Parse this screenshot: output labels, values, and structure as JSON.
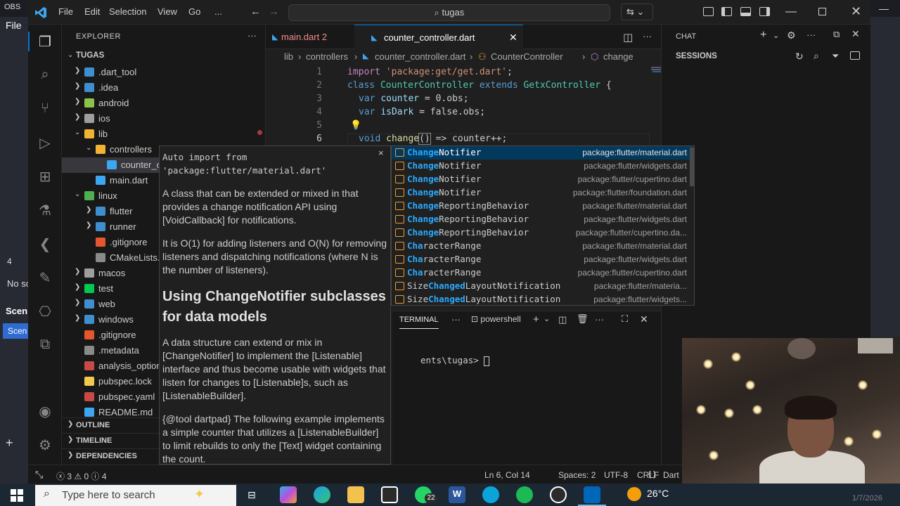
{
  "obs": {
    "title": "OBS",
    "menu_file": "File",
    "no_source": "No sc",
    "scenes_header": "Scen",
    "scene_item": "Scen",
    "left_value": "4"
  },
  "titlebar": {
    "menus": [
      "File",
      "Edit",
      "Selection",
      "View",
      "Go",
      "..."
    ],
    "search": "tugas"
  },
  "sidebar": {
    "title": "EXPLORER",
    "root": "TUGAS",
    "tree": [
      {
        "label": ".dart_tool",
        "depth": 1,
        "folder": true,
        "open": false
      },
      {
        "label": ".idea",
        "depth": 1,
        "folder": true,
        "open": false
      },
      {
        "label": "android",
        "depth": 1,
        "folder": true,
        "open": false
      },
      {
        "label": "ios",
        "depth": 1,
        "folder": true,
        "open": false
      },
      {
        "label": "lib",
        "depth": 1,
        "folder": true,
        "open": true
      },
      {
        "label": "controllers",
        "depth": 2,
        "folder": true,
        "open": true
      },
      {
        "label": "counter_con",
        "depth": 3,
        "folder": false,
        "selected": true
      },
      {
        "label": "main.dart",
        "depth": 2,
        "folder": false
      },
      {
        "label": "linux",
        "depth": 1,
        "folder": true,
        "open": true
      },
      {
        "label": "flutter",
        "depth": 2,
        "folder": true,
        "open": false
      },
      {
        "label": "runner",
        "depth": 2,
        "folder": true,
        "open": false
      },
      {
        "label": ".gitignore",
        "depth": 2,
        "folder": false
      },
      {
        "label": "CMakeLists.tx",
        "depth": 2,
        "folder": false
      },
      {
        "label": "macos",
        "depth": 1,
        "folder": true,
        "open": false
      },
      {
        "label": "test",
        "depth": 1,
        "folder": true,
        "open": false
      },
      {
        "label": "web",
        "depth": 1,
        "folder": true,
        "open": false
      },
      {
        "label": "windows",
        "depth": 1,
        "folder": true,
        "open": false
      },
      {
        "label": ".gitignore",
        "depth": 1,
        "folder": false
      },
      {
        "label": ".metadata",
        "depth": 1,
        "folder": false
      },
      {
        "label": "analysis_option",
        "depth": 1,
        "folder": false
      },
      {
        "label": "pubspec.lock",
        "depth": 1,
        "folder": false
      },
      {
        "label": "pubspec.yaml",
        "depth": 1,
        "folder": false
      },
      {
        "label": "README.md",
        "depth": 1,
        "folder": false
      }
    ],
    "sections": [
      "OUTLINE",
      "TIMELINE",
      "DEPENDENCIES"
    ]
  },
  "tabs": [
    {
      "label": "main.dart",
      "badge": "2",
      "active": false
    },
    {
      "label": "counter_controller.dart",
      "active": true
    }
  ],
  "breadcrumb": [
    "lib",
    "controllers",
    "counter_controller.dart",
    "CounterController",
    "change"
  ],
  "code": {
    "line_numbers": [
      "1",
      "2",
      "3",
      "4",
      "5",
      "6"
    ],
    "l1_kw": "import",
    "l1_str": "'package:get/get.dart'",
    "l1_end": ";",
    "l2_kw": "class",
    "l2_cls": "CounterController",
    "l2_kw2": "extends",
    "l2_cls2": "GetxController",
    "l2_end": " {",
    "l3_kw": "var",
    "l3_var": "counter",
    "l3_rest": " = 0.obs;",
    "l4_kw": "var",
    "l4_var": "isDark",
    "l4_rest": " = false.obs;",
    "l6_kw": "void",
    "l6_fn": "change",
    "l6_paren": "()",
    "l6_rest": " => counter++;"
  },
  "hover": {
    "header": "Auto import from 'package:flutter/material.dart'",
    "close": "×",
    "p1": "A class that can be extended or mixed in that provides a change notification API using [VoidCallback] for notifications.",
    "p2": "It is O(1) for adding listeners and O(N) for removing listeners and dispatching notifications (where N is the number of listeners).",
    "h2": "Using ChangeNotifier subclasses for data models",
    "p3": "A data structure can extend or mix in [ChangeNotifier] to implement the [Listenable] interface and thus become usable with widgets that listen for changes to [Listenable]s, such as [ListenableBuilder].",
    "p4": "{@tool dartpad} The following example implements a simple counter that utilizes a [ListenableBuilder] to limit rebuilds to only the [Text] widget containing the count."
  },
  "suggestions": [
    {
      "match": "Change",
      "rest": "Notifier",
      "pkg": "package:flutter/material.dart"
    },
    {
      "match": "Change",
      "rest": "Notifier",
      "pkg": "package:flutter/widgets.dart"
    },
    {
      "match": "Change",
      "rest": "Notifier",
      "pkg": "package:flutter/cupertino.dart"
    },
    {
      "match": "Change",
      "rest": "Notifier",
      "pkg": "package:flutter/foundation.dart"
    },
    {
      "match": "Change",
      "rest": "ReportingBehavior",
      "pkg": "package:flutter/material.dart"
    },
    {
      "match": "Change",
      "rest": "ReportingBehavior",
      "pkg": "package:flutter/widgets.dart"
    },
    {
      "match": "Change",
      "rest": "ReportingBehavior",
      "pkg": "package:flutter/cupertino.da..."
    },
    {
      "match": "Cha",
      "rest": "racterRange",
      "pkg": "package:flutter/material.dart"
    },
    {
      "match": "Cha",
      "rest": "racterRange",
      "pkg": "package:flutter/widgets.dart"
    },
    {
      "match": "Cha",
      "rest": "racterRange",
      "pkg": "package:flutter/cupertino.dart"
    },
    {
      "prefix": "Size",
      "match": "Changed",
      "rest": "LayoutNotification",
      "pkg": "package:flutter/materia..."
    },
    {
      "prefix": "Size",
      "match": "Changed",
      "rest": "LayoutNotification",
      "pkg": "package:flutter/widgets..."
    }
  ],
  "panel": {
    "tab": "TERMINAL",
    "shell": "powershell",
    "prompt": "ents\\tugas> "
  },
  "chat": {
    "title": "CHAT",
    "sessions": "SESSIONS"
  },
  "status": {
    "errors": "3",
    "warnings": "0",
    "info": "4",
    "position": "Ln 6, Col 14",
    "spaces": "Spaces: 2",
    "encoding": "UTF-8",
    "eol": "CRLF",
    "language": "Dart",
    "brackets": "{ }"
  },
  "taskbar": {
    "search_placeholder": "Type here to search",
    "whatsapp_badge": "22",
    "weather": "26°C",
    "date": "1/7/2026"
  },
  "colors": {
    "accent": "#0078d4",
    "keyword": "#c586c0",
    "type": "#4ec9b0",
    "string": "#ce9178",
    "match": "#2aaaff"
  }
}
